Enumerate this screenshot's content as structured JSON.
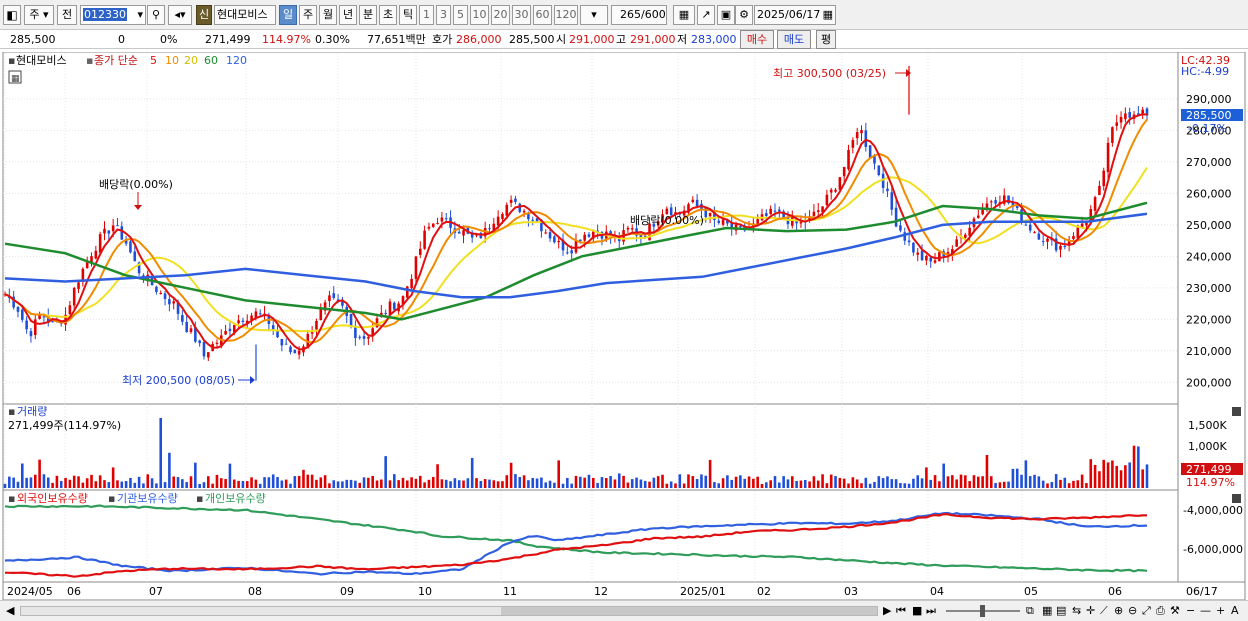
{
  "toolbar": {
    "mode_label": "주",
    "prev_label": "전",
    "code_value": "012330",
    "stock_badge": "신",
    "stock_name": "현대모비스",
    "periods": [
      "일",
      "주",
      "월",
      "년",
      "분",
      "초",
      "틱"
    ],
    "active_period": "일",
    "intervals": [
      "1",
      "3",
      "5",
      "10",
      "20",
      "30",
      "60",
      "120"
    ],
    "count_value": "265",
    "count_total": "/600",
    "date_value": "2025/06/17"
  },
  "info": {
    "price": "285,500",
    "change": "0",
    "change_pct": "0%",
    "volume": "271,499",
    "volume_pct": "114.97%",
    "turnover_pct": "0.30%",
    "amount": "77,651백만",
    "quote_label": "호가",
    "quote_ask": "286,000",
    "quote_bid": "285,500",
    "open_label": "시",
    "open": "291,000",
    "high_label": "고",
    "high": "291,000",
    "low_label": "저",
    "low": "283,000",
    "buy_label": "매수",
    "sell_label": "매도",
    "eval_label": "평"
  },
  "price_pane": {
    "stock_tag": "현대모비스",
    "ma_title": "종가 단순",
    "ma_periods": [
      "5",
      "10",
      "20",
      "60",
      "120"
    ],
    "lc": "LC:42.39",
    "hc": "HC:-4.99",
    "y_ticks": [
      "290,000",
      "280,000",
      "270,000",
      "260,000",
      "250,000",
      "240,000",
      "230,000",
      "220,000",
      "210,000",
      "200,000"
    ],
    "current_price_tag": "285,500",
    "current_change_tag": "-0.17%",
    "high_note": "최고 300,500 (03/25)",
    "low_note": "최저 200,500 (08/05)",
    "dividend_note_1": "배당락(0.00%)",
    "dividend_note_2": "배당락(0.00%)"
  },
  "volume_pane": {
    "title": "거래량",
    "value_label": "271,499주(114.97%)",
    "y_ticks": [
      "1,500K",
      "1,000K"
    ],
    "current_tag": "271,499",
    "current_pct": "114.97%"
  },
  "holding_pane": {
    "series": [
      "외국인보유수량",
      "기관보유수량",
      "개인보유수량"
    ],
    "y_ticks": [
      "-4,000,000",
      "-6,000,000"
    ]
  },
  "x_axis": {
    "labels": [
      "2024/05",
      "06",
      "07",
      "08",
      "09",
      "10",
      "11",
      "12",
      "2025/01",
      "02",
      "03",
      "04",
      "05",
      "06"
    ],
    "last_label": "06/17"
  },
  "colors": {
    "up": "#e00000",
    "down": "#1f4fd8",
    "ma5": "#e01010",
    "ma10": "#f08c00",
    "ma20": "#f0e020",
    "ma60": "#1e8c2e",
    "ma120": "#2f5fe0",
    "foreign": "#e01010",
    "institution": "#3060e0",
    "individual": "#2f9c5a"
  },
  "chart_data": {
    "type": "candlestick",
    "title": "현대모비스",
    "y_range": [
      195000,
      303000
    ],
    "x_range": [
      "2024/05",
      "2025/06/17"
    ],
    "close_series": [
      [
        0,
        228000
      ],
      [
        10,
        224000
      ],
      [
        20,
        215000
      ],
      [
        30,
        222000
      ],
      [
        40,
        218000
      ],
      [
        50,
        221000
      ],
      [
        60,
        232000
      ],
      [
        70,
        240000
      ],
      [
        80,
        246000
      ],
      [
        90,
        250000
      ],
      [
        100,
        245000
      ],
      [
        110,
        236000
      ],
      [
        120,
        232000
      ],
      [
        130,
        228000
      ],
      [
        140,
        225000
      ],
      [
        150,
        218000
      ],
      [
        160,
        213000
      ],
      [
        165,
        208000
      ],
      [
        170,
        211000
      ],
      [
        180,
        214000
      ],
      [
        190,
        219000
      ],
      [
        200,
        221000
      ],
      [
        210,
        222000
      ],
      [
        220,
        219000
      ],
      [
        230,
        212000
      ],
      [
        240,
        209000
      ],
      [
        250,
        213000
      ],
      [
        260,
        221000
      ],
      [
        270,
        226000
      ],
      [
        280,
        224000
      ],
      [
        290,
        216000
      ],
      [
        300,
        214000
      ],
      [
        310,
        220000
      ],
      [
        320,
        224000
      ],
      [
        330,
        226000
      ],
      [
        340,
        236000
      ],
      [
        350,
        248000
      ],
      [
        360,
        252000
      ],
      [
        370,
        250000
      ],
      [
        380,
        248000
      ],
      [
        390,
        245000
      ],
      [
        400,
        248000
      ],
      [
        410,
        254000
      ],
      [
        420,
        257000
      ],
      [
        430,
        255000
      ],
      [
        440,
        252000
      ],
      [
        450,
        248000
      ],
      [
        460,
        244000
      ],
      [
        470,
        242000
      ],
      [
        480,
        247000
      ],
      [
        490,
        248000
      ],
      [
        500,
        247000
      ],
      [
        510,
        245000
      ],
      [
        520,
        249000
      ],
      [
        530,
        246000
      ],
      [
        540,
        251000
      ],
      [
        550,
        256000
      ],
      [
        560,
        253000
      ],
      [
        570,
        257000
      ],
      [
        580,
        255000
      ],
      [
        590,
        251000
      ],
      [
        600,
        250000
      ],
      [
        610,
        248000
      ],
      [
        620,
        249000
      ],
      [
        630,
        252000
      ],
      [
        640,
        254000
      ],
      [
        650,
        252000
      ],
      [
        660,
        250000
      ],
      [
        670,
        252000
      ],
      [
        680,
        256000
      ],
      [
        690,
        262000
      ],
      [
        700,
        270000
      ],
      [
        710,
        282000
      ],
      [
        720,
        272000
      ],
      [
        730,
        264000
      ],
      [
        740,
        252000
      ],
      [
        750,
        245000
      ],
      [
        760,
        240000
      ],
      [
        770,
        238000
      ],
      [
        780,
        241000
      ],
      [
        790,
        243000
      ],
      [
        800,
        249000
      ],
      [
        810,
        254000
      ],
      [
        820,
        258000
      ],
      [
        830,
        259000
      ],
      [
        840,
        255000
      ],
      [
        850,
        250000
      ],
      [
        860,
        247000
      ],
      [
        870,
        244000
      ],
      [
        880,
        243000
      ],
      [
        890,
        248000
      ],
      [
        900,
        252000
      ],
      [
        910,
        260000
      ],
      [
        920,
        279000
      ],
      [
        930,
        287000
      ],
      [
        940,
        284000
      ],
      [
        950,
        285500
      ]
    ],
    "ma60_series": [
      [
        0,
        244000
      ],
      [
        50,
        241000
      ],
      [
        100,
        234000
      ],
      [
        150,
        230000
      ],
      [
        200,
        226000
      ],
      [
        250,
        224000
      ],
      [
        300,
        222000
      ],
      [
        330,
        220000
      ],
      [
        360,
        223000
      ],
      [
        400,
        227000
      ],
      [
        440,
        234000
      ],
      [
        480,
        240000
      ],
      [
        520,
        243000
      ],
      [
        560,
        246000
      ],
      [
        600,
        249000
      ],
      [
        650,
        248000
      ],
      [
        700,
        248500
      ],
      [
        740,
        251000
      ],
      [
        780,
        256000
      ],
      [
        820,
        255000
      ],
      [
        860,
        253000
      ],
      [
        900,
        252000
      ],
      [
        950,
        257000
      ]
    ],
    "ma120_series": [
      [
        0,
        233000
      ],
      [
        50,
        232000
      ],
      [
        100,
        233000
      ],
      [
        150,
        234000
      ],
      [
        200,
        236000
      ],
      [
        250,
        234000
      ],
      [
        300,
        232000
      ],
      [
        340,
        229000
      ],
      [
        380,
        227000
      ],
      [
        420,
        227000
      ],
      [
        460,
        229000
      ],
      [
        500,
        231500
      ],
      [
        540,
        232500
      ],
      [
        580,
        233500
      ],
      [
        620,
        236500
      ],
      [
        660,
        239500
      ],
      [
        700,
        242500
      ],
      [
        740,
        246000
      ],
      [
        780,
        250000
      ],
      [
        820,
        251000
      ],
      [
        860,
        251000
      ],
      [
        900,
        251000
      ],
      [
        950,
        253500
      ]
    ],
    "annotations": [
      {
        "label": "최고",
        "value": 300500,
        "date": "03/25"
      },
      {
        "label": "최저",
        "value": 200500,
        "date": "08/05"
      }
    ]
  }
}
